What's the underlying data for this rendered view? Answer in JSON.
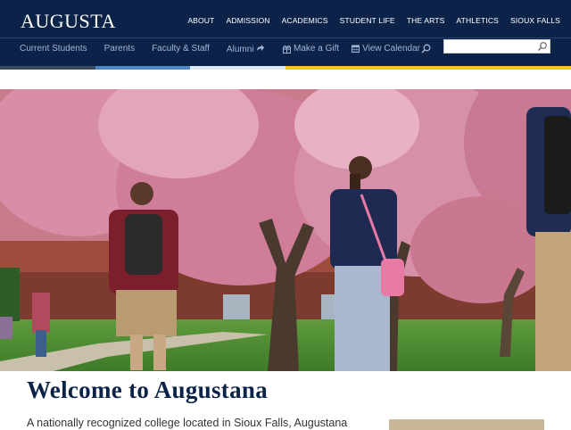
{
  "header": {
    "logo": "AUGUSTA",
    "main_nav": [
      "ABOUT",
      "ADMISSION",
      "ACADEMICS",
      "STUDENT LIFE",
      "THE ARTS",
      "ATHLETICS",
      "SIOUX FALLS"
    ],
    "utility_nav": [
      "Current Students",
      "Parents",
      "Faculty & Staff",
      "Alumni"
    ],
    "make_gift": "Make a Gift",
    "view_calendar": "View Calendar",
    "search": {
      "value": "",
      "placeholder": ""
    }
  },
  "colors": {
    "navy": "#0b2348",
    "stripe_gray": "#3a4a60",
    "stripe_blue": "#4f87c6",
    "stripe_white": "#dfe7f1",
    "stripe_gold": "#f5c518"
  },
  "icons": [
    "gift-icon",
    "calendar-icon",
    "search-icon",
    "alumni-arrow-icon"
  ],
  "main": {
    "title": "Welcome to Augustana",
    "intro": "A nationally recognized college located in Sioux Falls, Augustana"
  }
}
